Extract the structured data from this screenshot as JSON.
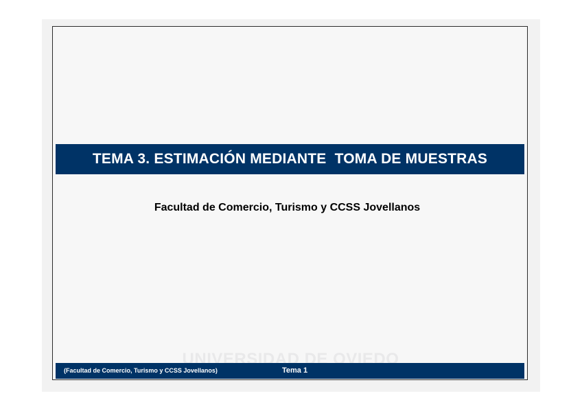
{
  "slide": {
    "title": "TEMA 3. ESTIMACIÓN MEDIANTE  TOMA DE MUESTRAS",
    "subtitle": "Facultad de Comercio, Turismo y CCSS Jovellanos",
    "watermark": "UNIVERSIDAD DE OVIEDO",
    "footer": {
      "left": "(Facultad de Comercio, Turismo y CCSS Jovellanos)",
      "center": "Tema 1"
    }
  },
  "colors": {
    "band": "#003366",
    "background": "#f7f7f7",
    "text_on_band": "#ffffff"
  }
}
